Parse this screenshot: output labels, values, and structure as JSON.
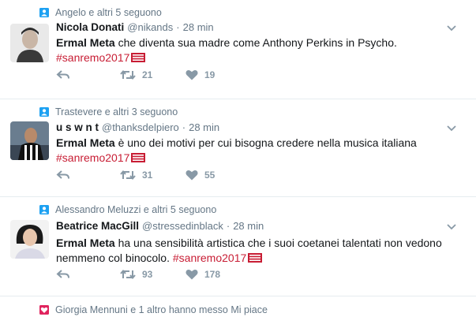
{
  "tweets": [
    {
      "context": "Angelo e altri 5 seguono",
      "context_type": "follow",
      "name": "Nicola Donati",
      "handle": "@nikands",
      "separator": "·",
      "time": "28 min",
      "lead": "Ermal Meta",
      "body": " che diventa sua madre come Anthony Perkins in Psycho.",
      "hashtag": "#sanremo2017",
      "retweets": "21",
      "likes": "19"
    },
    {
      "context": "Trastevere e altri 3 seguono",
      "context_type": "follow",
      "name": "u s w n t",
      "handle": "@thanksdelpiero",
      "separator": "·",
      "time": "28 min",
      "lead": "Ermal Meta",
      "body": " è uno dei motivi per cui bisogna credere nella musica italiana",
      "hashtag": "#sanremo2017",
      "retweets": "31",
      "likes": "55"
    },
    {
      "context": "Alessandro Meluzzi e altri 5 seguono",
      "context_type": "follow",
      "name": "Beatrice MacGill",
      "handle": "@stressedinblack",
      "separator": "·",
      "time": "28 min",
      "lead": "Ermal Meta",
      "body_line1": " ha una sensibilità artistica che i suoi coetanei talentati non vedono",
      "body_line2": "nemmeno col binocolo. ",
      "hashtag": "#sanremo2017",
      "retweets": "93",
      "likes": "178"
    },
    {
      "context": "Giorgia Mennuni e 1 altro hanno messo Mi piace",
      "context_type": "like"
    }
  ],
  "colors": {
    "hashtag": "#c81d34",
    "muted": "#657786",
    "icon": "#8899a6",
    "follow_icon": "#1da1f2",
    "like_icon": "#e0245e"
  },
  "icons": {
    "context_follow": "person-icon",
    "context_like": "heart-icon",
    "reply": "reply-icon",
    "retweet": "retweet-icon",
    "like": "heart-icon",
    "menu": "chevron-down-icon",
    "hashflag": "sanremo-flag-icon"
  }
}
